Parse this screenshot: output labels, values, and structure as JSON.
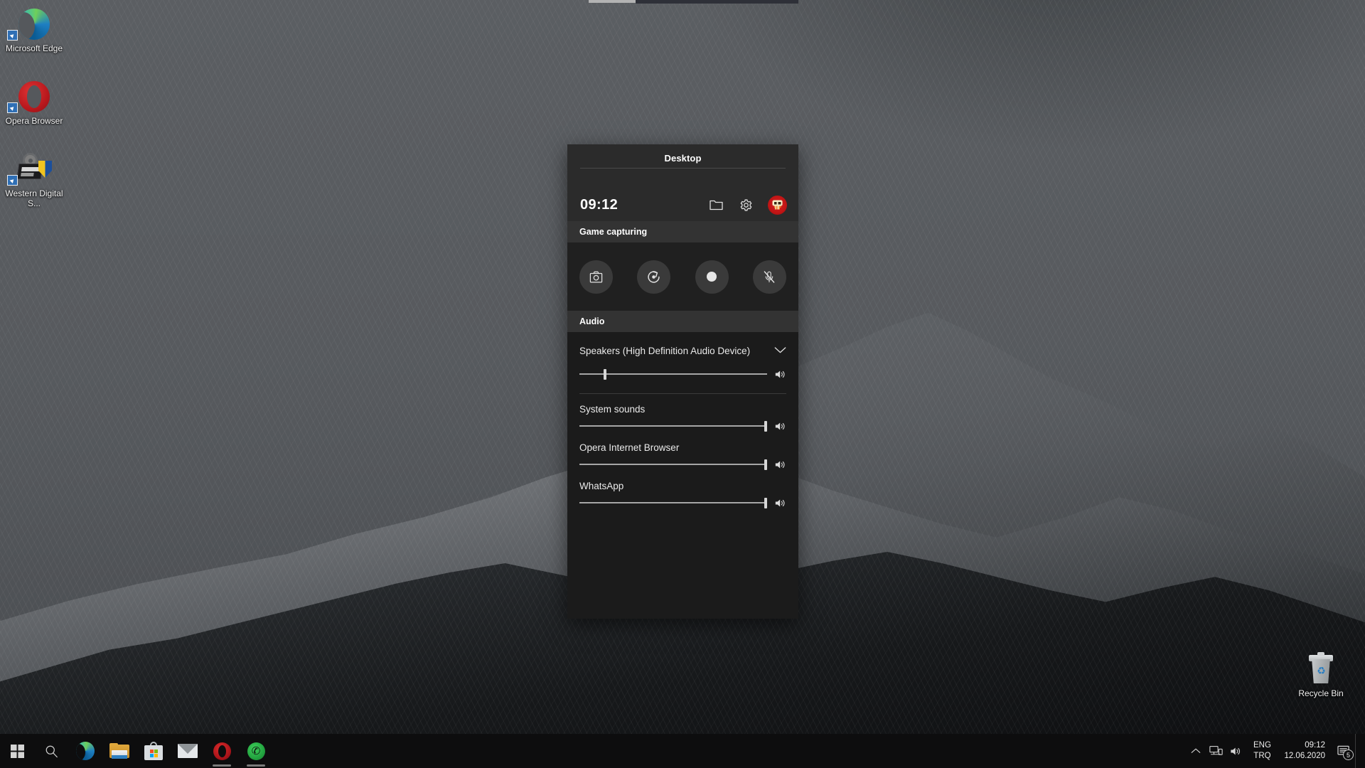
{
  "desktop": {
    "icons": [
      {
        "label": "Microsoft Edge",
        "icon": "edge-icon"
      },
      {
        "label": "Opera Browser",
        "icon": "opera-icon"
      },
      {
        "label": "Western Digital S...",
        "icon": "western-digital-icon"
      }
    ],
    "recycle_bin": {
      "label": "Recycle Bin",
      "icon": "recycle-bin-icon"
    }
  },
  "gamebar": {
    "title": "Desktop",
    "clock": "09:12",
    "header_actions": {
      "widget_menu": "widget-menu-icon",
      "settings": "gear-icon",
      "avatar": "skull-avatar"
    },
    "capture": {
      "section_title": "Game capturing",
      "buttons": [
        {
          "name": "screenshot-button",
          "icon": "camera-icon"
        },
        {
          "name": "record-last-30s-button",
          "icon": "rewind-record-icon"
        },
        {
          "name": "start-recording-button",
          "icon": "record-dot-icon"
        },
        {
          "name": "toggle-mic-button",
          "icon": "mic-muted-icon"
        }
      ]
    },
    "audio": {
      "section_title": "Audio",
      "device": {
        "name": "Speakers (High Definition Audio Device)",
        "chevron": "chevron-down-icon",
        "volume_percent": 13,
        "volume_icon": "speaker-icon"
      },
      "apps": [
        {
          "name": "System sounds",
          "volume_percent": 100,
          "volume_icon": "speaker-icon"
        },
        {
          "name": "Opera Internet Browser",
          "volume_percent": 100,
          "volume_icon": "speaker-icon"
        },
        {
          "name": "WhatsApp",
          "volume_percent": 100,
          "volume_icon": "speaker-icon"
        }
      ]
    }
  },
  "taskbar": {
    "items": [
      {
        "name": "start-button",
        "icon": "windows-logo-icon",
        "running": false
      },
      {
        "name": "search-button",
        "icon": "search-icon",
        "running": false
      },
      {
        "name": "taskbar-edge",
        "icon": "edge-icon",
        "running": false
      },
      {
        "name": "taskbar-file-explorer",
        "icon": "folder-icon",
        "running": false
      },
      {
        "name": "taskbar-microsoft-store",
        "icon": "store-icon",
        "running": false
      },
      {
        "name": "taskbar-mail",
        "icon": "mail-icon",
        "running": false
      },
      {
        "name": "taskbar-opera",
        "icon": "opera-icon",
        "running": true
      },
      {
        "name": "taskbar-whatsapp",
        "icon": "whatsapp-icon",
        "running": true
      }
    ],
    "tray": {
      "show_hidden": "chevron-up-icon",
      "network": "network-icon",
      "volume": "speaker-icon",
      "language_primary": "ENG",
      "language_secondary": "TRQ",
      "time": "09:12",
      "date": "12.06.2020",
      "notifications_icon": "action-center-icon",
      "notifications_count": "5"
    }
  },
  "colors": {
    "accent_red": "#c01414",
    "panel_bg": "#1b1b1b",
    "panel_header": "#2b2b2b",
    "section_header": "#333333",
    "taskbar_bg": "#0d0d0e"
  }
}
